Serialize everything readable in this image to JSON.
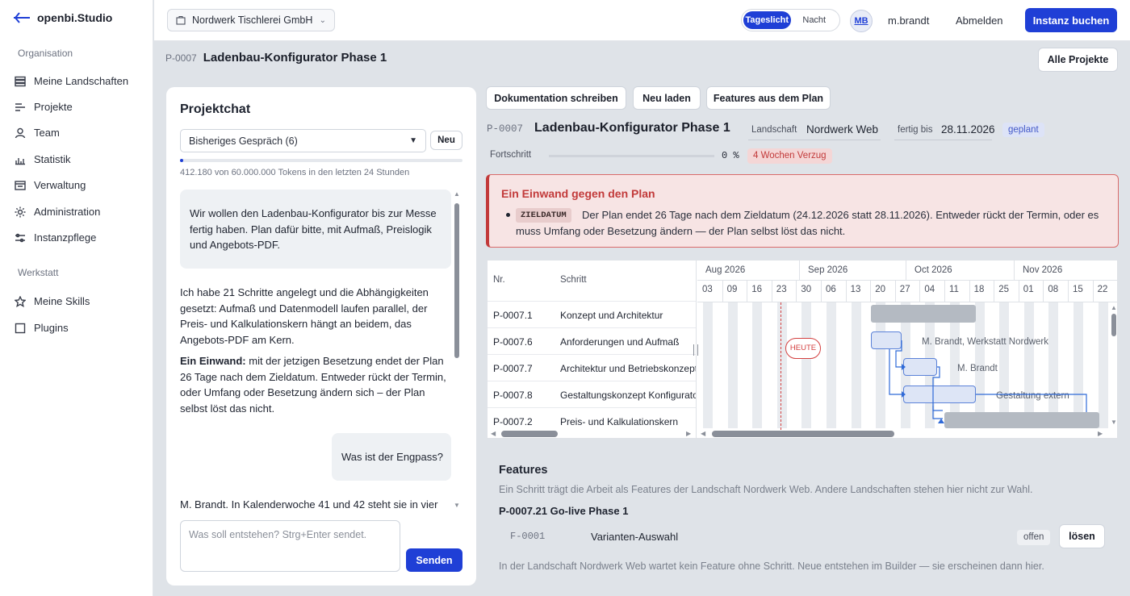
{
  "app": {
    "name": "openbi.Studio"
  },
  "sidebar": {
    "section_org": "Organisation",
    "org_items": [
      {
        "label": "Meine Landschaften",
        "icon": "layers-icon"
      },
      {
        "label": "Projekte",
        "icon": "list-icon"
      },
      {
        "label": "Team",
        "icon": "user-icon"
      },
      {
        "label": "Statistik",
        "icon": "bar-chart-icon"
      },
      {
        "label": "Verwaltung",
        "icon": "admin-panel-icon"
      },
      {
        "label": "Administration",
        "icon": "sun-gear-icon"
      },
      {
        "label": "Instanzpflege",
        "icon": "sliders-icon"
      }
    ],
    "section_work": "Werkstatt",
    "work_items": [
      {
        "label": "Meine Skills",
        "icon": "star-icon"
      },
      {
        "label": "Plugins",
        "icon": "square-icon"
      }
    ]
  },
  "topbar": {
    "org": "Nordwerk Tischlerei GmbH",
    "theme_day": "Tageslicht",
    "theme_night": "Nacht",
    "avatar": "MB",
    "user": "m.brandt",
    "logout": "Abmelden",
    "book": "Instanz buchen"
  },
  "page": {
    "id": "P-0007",
    "title": "Ladenbau-Konfigurator Phase 1",
    "all_projects": "Alle Projekte"
  },
  "chat": {
    "title": "Projektchat",
    "conversation": "Bisheriges Gespräch (6)",
    "new": "Neu",
    "token_fraction": 0.0069,
    "tokens": "412.180 von 60.000.000 Tokens in den letzten 24 Stunden",
    "msg1": "Wir wollen den Ladenbau-Konfigurator bis zur Messe fertig haben. Plan dafür bitte, mit Aufmaß, Preislogik und Angebots-PDF.",
    "msg2": "Ich habe 21 Schritte angelegt und die Abhängigkeiten gesetzt: Aufmaß und Datenmodell laufen parallel, der Preis- und Kalkulationskern hängt an beidem, das Angebots-PDF am Kern.",
    "msg3_bold": "Ein Einwand:",
    "msg3": " mit der jetzigen Besetzung endet der Plan 26 Tage nach dem Zieldatum. Entweder rückt der Termin, oder Umfang oder Besetzung ändern sich – der Plan selbst löst das nicht.",
    "msg4": "Was ist der Engpass?",
    "msg5": "M. Brandt. In Kalenderwoche 41 und 42 steht sie in vier",
    "placeholder": "Was soll entstehen? Strg+Enter sendet.",
    "send": "Senden"
  },
  "actions": {
    "doc": "Dokumentation schreiben",
    "reload": "Neu laden",
    "features": "Features aus dem Plan"
  },
  "detail": {
    "id": "P-0007",
    "title": "Ladenbau-Konfigurator Phase 1",
    "landscape_label": "Landschaft",
    "landscape": "Nordwerk Web",
    "due_label": "fertig bis",
    "due": "28.11.2026",
    "status": "geplant",
    "progress_label": "Fortschritt",
    "progress": "0 %",
    "progress_fraction": 0,
    "delay": "4 Wochen Verzug"
  },
  "objection": {
    "title": "Ein Einwand gegen den Plan",
    "tag": "ZIELDATUM",
    "text": "Der Plan endet 26 Tage nach dem Zieldatum (24.12.2026 statt 28.11.2026). Entweder rückt der Termin, oder es muss Umfang oder Besetzung ändern — der Plan selbst löst das nicht."
  },
  "gantt": {
    "col_nr": "Nr.",
    "col_step": "Schritt",
    "months": [
      "Aug 2026",
      "Sep 2026",
      "Oct 2026",
      "Nov 2026"
    ],
    "weeks": [
      "03",
      "09",
      "16",
      "23",
      "30",
      "06",
      "13",
      "20",
      "27",
      "04",
      "11",
      "18",
      "25",
      "01",
      "08",
      "15",
      "22"
    ],
    "today": "HEUTE",
    "rows": [
      {
        "nr": "P-0007.1",
        "step": "Konzept und Architektur",
        "label": ""
      },
      {
        "nr": "P-0007.6",
        "step": "Anforderungen und Aufmaß",
        "label": "M. Brandt, Werkstatt Nordwerk"
      },
      {
        "nr": "P-0007.7",
        "step": "Architektur und Betriebskonzept",
        "label": "M. Brandt"
      },
      {
        "nr": "P-0007.8",
        "step": "Gestaltungskonzept Konfigurator",
        "label": "Gestaltung extern"
      },
      {
        "nr": "P-0007.2",
        "step": "Preis- und Kalkulationskern",
        "label": ""
      }
    ]
  },
  "features": {
    "title": "Features",
    "desc": "Ein Schritt trägt die Arbeit als Features der Landschaft Nordwerk Web. Andere Landschaften stehen hier nicht zur Wahl.",
    "step": "P-0007.21 Go-live Phase 1",
    "item_id": "F-0001",
    "item_name": "Varianten-Auswahl",
    "item_status": "offen",
    "item_action": "lösen",
    "note": "In der Landschaft Nordwerk Web wartet kein Feature ohne Schritt. Neue entstehen im Builder — sie erscheinen dann hier."
  }
}
